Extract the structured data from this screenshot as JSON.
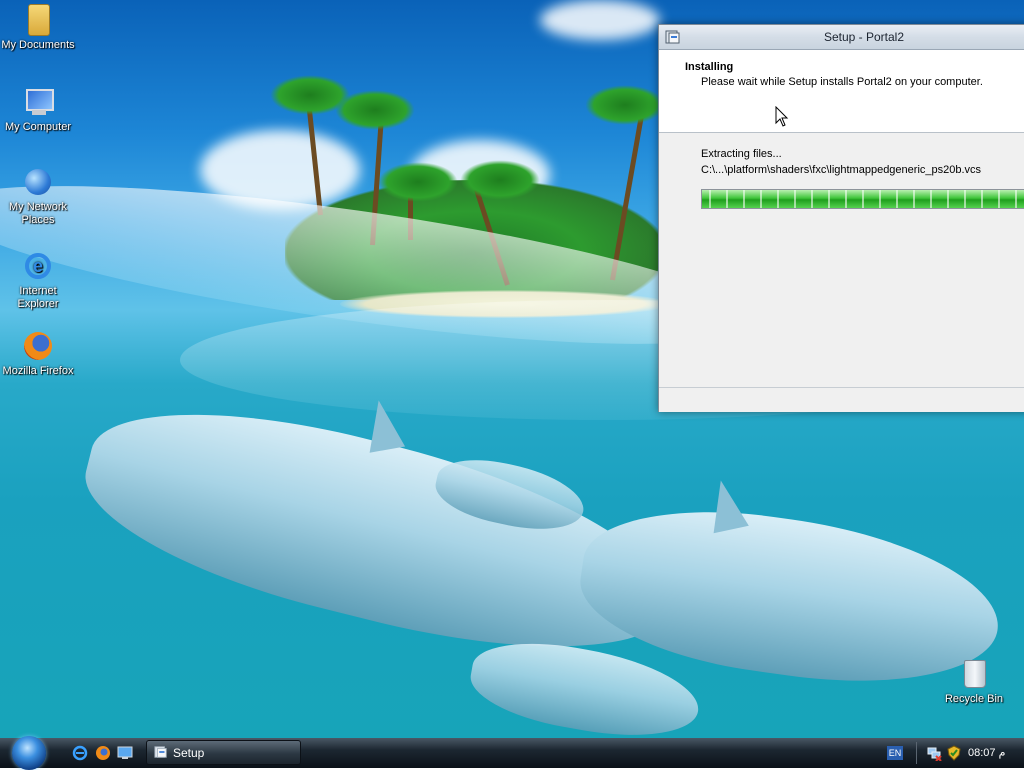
{
  "desktop": {
    "icons": [
      {
        "label": "My Documents"
      },
      {
        "label": "My Computer"
      },
      {
        "label": "My Network Places"
      },
      {
        "label": "Internet Explorer"
      },
      {
        "label": "Mozilla Firefox"
      },
      {
        "label": "Recycle Bin"
      }
    ]
  },
  "window": {
    "title": "Setup - Portal2",
    "header": {
      "title": "Installing",
      "subtitle": "Please wait while Setup installs Portal2 on your computer."
    },
    "status": "Extracting files...",
    "current_file": "C:\\...\\platform\\shaders\\fxc\\lightmappedgeneric_ps20b.vcs",
    "progress_fraction": 1.0
  },
  "taskbar": {
    "buttons": [
      {
        "label": "Setup"
      }
    ],
    "language": "EN",
    "clock": "08:07 م"
  },
  "colors": {
    "progress_green": "#3fc53a",
    "taskbar_dark": "#1c2731"
  }
}
